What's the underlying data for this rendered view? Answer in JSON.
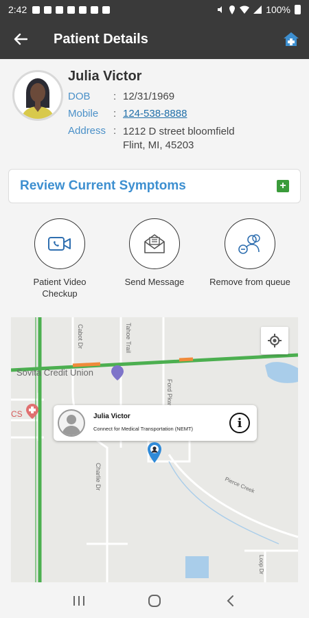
{
  "status_bar": {
    "time": "2:42",
    "battery": "100%"
  },
  "header": {
    "title": "Patient Details"
  },
  "patient": {
    "name": "Julia Victor",
    "dob_label": "DOB",
    "dob": "12/31/1969",
    "mobile_label": "Mobile",
    "mobile": "124-538-8888",
    "address_label": "Address",
    "address_line1": "1212 D street bloomfield",
    "address_line2": "Flint, MI, 45203"
  },
  "symptoms": {
    "title": "Review Current Symptoms"
  },
  "actions": [
    {
      "label_line1": "Patient Video",
      "label_line2": "Checkup",
      "icon": "video-call-icon"
    },
    {
      "label_line1": "Send Message",
      "label_line2": "",
      "icon": "envelope-icon"
    },
    {
      "label_line1": "Remove from queue",
      "label_line2": "",
      "icon": "remove-users-icon"
    }
  ],
  "map": {
    "poi_credit_union": "Sovita Credit Union",
    "poi_cs": "CS",
    "street_cabot": "Cabot Dr",
    "street_tahoe": "Tahoe Trail",
    "street_ford": "Ford Pkwy",
    "street_charlie": "Charlie Dr",
    "street_pierce": "Pierce Creek",
    "street_loop": "Loop Dr",
    "info_window": {
      "name": "Julia Victor",
      "description": "Connect for Medical Transportation (NEMT)",
      "info_symbol": "i"
    }
  },
  "colors": {
    "app_bar": "#3a3a3a",
    "accent_blue": "#3d8fd0",
    "label_blue": "#4a90c8",
    "add_green": "#3a9b3a",
    "map_road_green": "#4caf50",
    "map_water": "#a9cdea"
  }
}
